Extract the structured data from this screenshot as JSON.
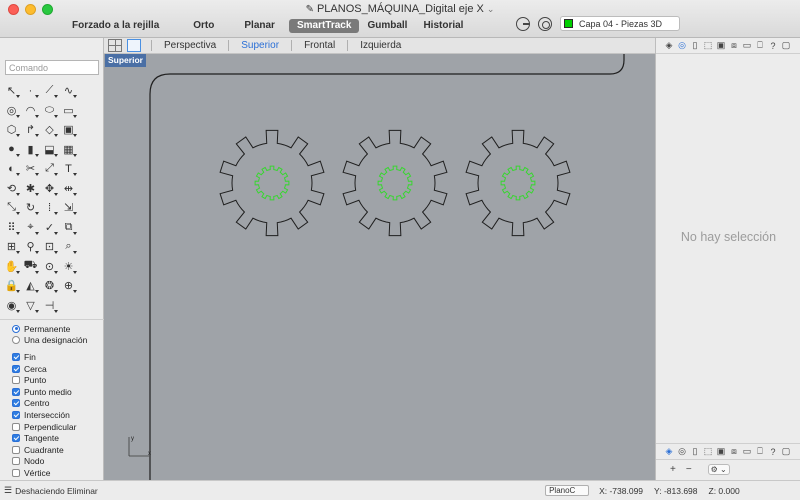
{
  "window": {
    "title": "PLANOS_MÁQUINA_Digital eje X",
    "title_chevron": "⌄"
  },
  "toolbar": {
    "modes": [
      {
        "label": "Forzado a la rejilla",
        "active": false
      },
      {
        "label": "Orto",
        "active": false
      },
      {
        "label": "Planar",
        "active": false
      },
      {
        "label": "SmartTrack",
        "active": true
      },
      {
        "label": "Gumball",
        "active": false
      },
      {
        "label": "Historial",
        "active": false
      }
    ],
    "layer": {
      "label": "Capa 04 - Piezas 3D",
      "color": "#00d000"
    }
  },
  "left_panel": {
    "command_placeholder": "Comando",
    "osnap_modes": [
      {
        "label": "Permanente",
        "type": "radio",
        "checked": true
      },
      {
        "label": "Una designación",
        "type": "radio",
        "checked": false
      }
    ],
    "osnaps": [
      {
        "label": "Fin",
        "checked": true
      },
      {
        "label": "Cerca",
        "checked": true
      },
      {
        "label": "Punto",
        "checked": false
      },
      {
        "label": "Punto medio",
        "checked": true
      },
      {
        "label": "Centro",
        "checked": true
      },
      {
        "label": "Intersección",
        "checked": true
      },
      {
        "label": "Perpendicular",
        "checked": false
      },
      {
        "label": "Tangente",
        "checked": true
      },
      {
        "label": "Cuadrante",
        "checked": false
      },
      {
        "label": "Nodo",
        "checked": false
      },
      {
        "label": "Vértice",
        "checked": false
      }
    ]
  },
  "viewport_tabs": [
    {
      "label": "Perspectiva",
      "active": false
    },
    {
      "label": "Superior",
      "active": true
    },
    {
      "label": "Frontal",
      "active": false
    },
    {
      "label": "Izquierda",
      "active": false
    }
  ],
  "viewport": {
    "label": "Superior",
    "background": "#9fa3a8",
    "curve_color": "#1f1f1f",
    "selected_color": "#38d630",
    "axis_labels": {
      "y": "y",
      "x": "x"
    }
  },
  "right_panel": {
    "empty_text": "No hay selección",
    "add_label": "+",
    "remove_label": "−",
    "gear_label": "⚙ ⌄"
  },
  "status_bar": {
    "menu_icon": "☰",
    "command_text": "Deshaciendo Eliminar",
    "plane": "PlanoC",
    "x": "X: -738.099",
    "y": "Y: -813.698",
    "z": "Z: 0.000"
  }
}
